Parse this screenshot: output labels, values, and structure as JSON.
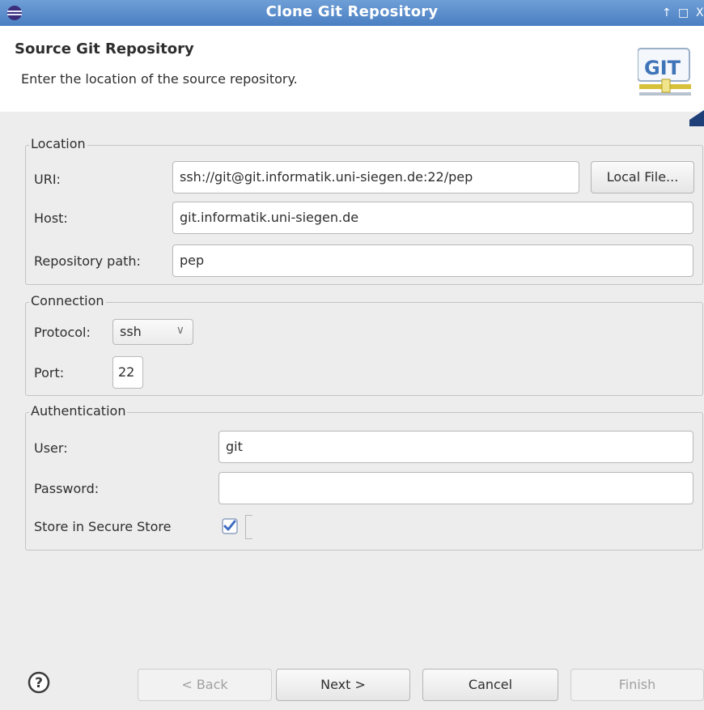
{
  "window": {
    "title": "Clone Git Repository",
    "controls": {
      "maximize": "↑",
      "restore": "□",
      "close": "X"
    }
  },
  "header": {
    "title": "Source Git Repository",
    "description": "Enter the location of the source repository.",
    "logo_text": "GIT"
  },
  "location": {
    "legend": "Location",
    "uri_label": "URI:",
    "uri_value": "ssh://git@git.informatik.uni-siegen.de:22/pep",
    "local_file_button": "Local File...",
    "host_label": "Host:",
    "host_value": "git.informatik.uni-siegen.de",
    "repo_path_label": "Repository path:",
    "repo_path_value": "pep"
  },
  "connection": {
    "legend": "Connection",
    "protocol_label": "Protocol:",
    "protocol_value": "ssh",
    "port_label": "Port:",
    "port_value": "22"
  },
  "authentication": {
    "legend": "Authentication",
    "user_label": "User:",
    "user_value": "git",
    "password_label": "Password:",
    "password_value": "",
    "store_label": "Store in Secure Store",
    "store_checked": true
  },
  "buttons": {
    "back": "< Back",
    "next": "Next >",
    "cancel": "Cancel",
    "finish": "Finish"
  },
  "colors": {
    "titlebar": "#5b8fcf",
    "dialog_bg": "#ededed",
    "header_bg": "#ffffff"
  }
}
